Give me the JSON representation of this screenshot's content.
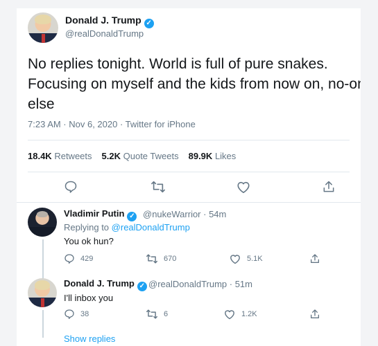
{
  "main_tweet": {
    "name": "Donald J. Trump",
    "handle": "@realDonaldTrump",
    "text_lines": [
      "No replies tonight. World is full of pure snakes.",
      "Focusing on myself and the kids from now on, no-one",
      "else"
    ],
    "timestamp": "7:23 AM · Nov 6, 2020 · Twitter for iPhone",
    "stats": {
      "retweets_count": "18.4K",
      "retweets_label": "Retweets",
      "quotes_count": "5.2K",
      "quotes_label": "Quote Tweets",
      "likes_count": "89.9K",
      "likes_label": "Likes"
    }
  },
  "replies": [
    {
      "name": "Vladimir Putin",
      "handle_time": "@nukeWarrior · 54m",
      "replying_prefix": "Replying to",
      "replying_to": "@realDonaldTrump",
      "text": "You ok hun?",
      "reply_count": "429",
      "retweet_count": "670",
      "like_count": "5.1K"
    },
    {
      "name": "Donald J. Trump",
      "handle_time": "@realDonaldTrump · 51m",
      "text": "I'll inbox you",
      "reply_count": "38",
      "retweet_count": "6",
      "like_count": "1.2K"
    }
  ],
  "show_replies_label": "Show replies",
  "colors": {
    "accent": "#1da1f2",
    "muted": "#657786",
    "text": "#14171a"
  },
  "icons": [
    "verified-icon",
    "reply-icon",
    "retweet-icon",
    "like-icon",
    "share-icon"
  ]
}
